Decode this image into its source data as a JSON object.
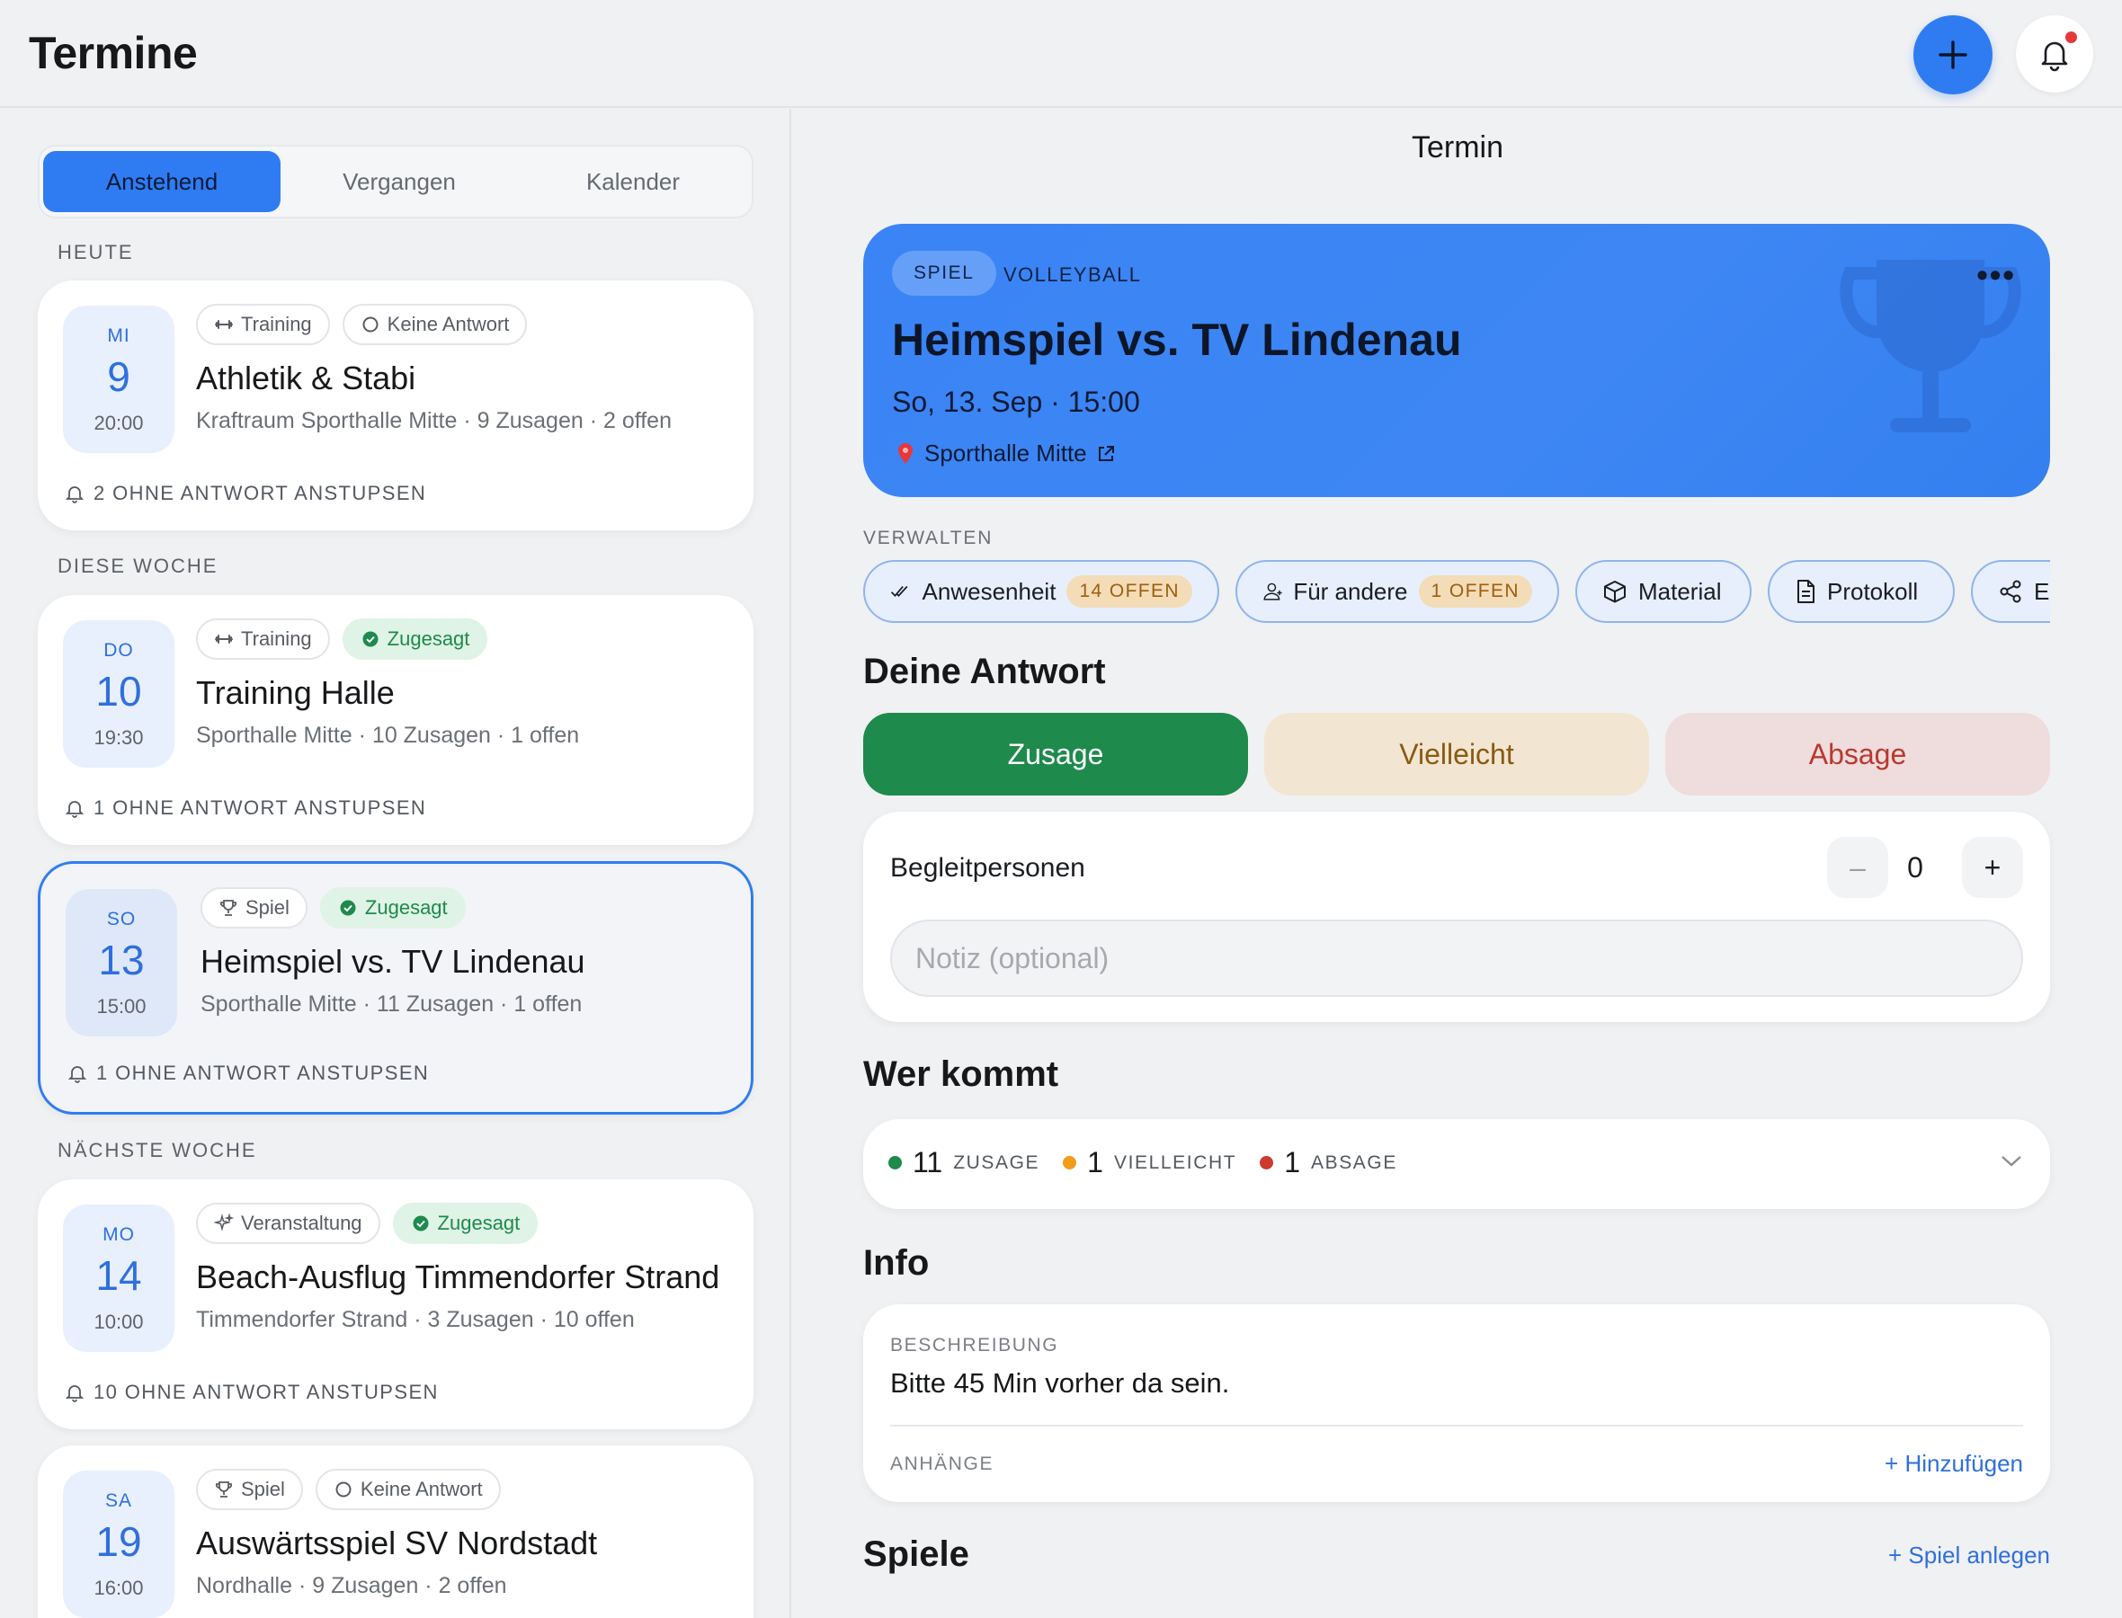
{
  "header": {
    "title": "Termine"
  },
  "tabs": [
    {
      "label": "Anstehend",
      "active": true
    },
    {
      "label": "Vergangen",
      "active": false
    },
    {
      "label": "Kalender",
      "active": false
    }
  ],
  "sections": {
    "today": "HEUTE",
    "this_week": "DIESE WOCHE",
    "next_week": "NÄCHSTE WOCHE"
  },
  "events": [
    {
      "dow": "MI",
      "day": "9",
      "time": "20:00",
      "type": "Training",
      "type_icon": "dumbbell-icon",
      "status": "Keine Antwort",
      "status_icon": "empty-circle-icon",
      "title": "Athletik & Stabi",
      "subtitle": "Kraftraum Sporthalle Mitte · 9 Zusagen · 2 offen",
      "nudge": "2 OHNE ANTWORT ANSTUPSEN"
    },
    {
      "dow": "DO",
      "day": "10",
      "time": "19:30",
      "type": "Training",
      "type_icon": "dumbbell-icon",
      "status": "Zugesagt",
      "status_icon": "check-circle-icon",
      "title": "Training Halle",
      "subtitle": "Sporthalle Mitte · 10 Zusagen · 1 offen",
      "nudge": "1 OHNE ANTWORT ANSTUPSEN"
    },
    {
      "dow": "SO",
      "day": "13",
      "time": "15:00",
      "type": "Spiel",
      "type_icon": "trophy-icon",
      "status": "Zugesagt",
      "status_icon": "check-circle-icon",
      "title": "Heimspiel vs. TV Lindenau",
      "subtitle": "Sporthalle Mitte · 11 Zusagen · 1 offen",
      "nudge": "1 OHNE ANTWORT ANSTUPSEN",
      "selected": true
    },
    {
      "dow": "MO",
      "day": "14",
      "time": "10:00",
      "type": "Veranstaltung",
      "type_icon": "sparkles-icon",
      "status": "Zugesagt",
      "status_icon": "check-circle-icon",
      "title": "Beach-Ausflug Timmendorfer Strand",
      "subtitle": "Timmendorfer Strand · 3 Zusagen · 10 offen",
      "nudge": "10 OHNE ANTWORT ANSTUPSEN"
    },
    {
      "dow": "SA",
      "day": "19",
      "time": "16:00",
      "type": "Spiel",
      "type_icon": "trophy-icon",
      "status": "Keine Antwort",
      "status_icon": "empty-circle-icon",
      "title": "Auswärtsspiel SV Nordstadt",
      "subtitle": "Nordhalle · 9 Zusagen · 2 offen"
    }
  ],
  "detail": {
    "pane_title": "Termin",
    "badge": "SPIEL",
    "sport": "VOLLEYBALL",
    "title": "Heimspiel vs. TV Lindenau",
    "datetime": "So, 13. Sep · 15:00",
    "location": "Sporthalle Mitte",
    "more": "•••",
    "manage_label": "VERWALTEN",
    "manage": [
      {
        "label": "Anwesenheit",
        "icon": "double-check-icon",
        "badge": "14 OFFEN"
      },
      {
        "label": "Für andere",
        "icon": "person-icon",
        "badge": "1 OFFEN"
      },
      {
        "label": "Material",
        "icon": "box-icon"
      },
      {
        "label": "Protokoll",
        "icon": "document-icon"
      },
      {
        "label": "Ex",
        "icon": "share-icon"
      }
    ],
    "your_answer_heading": "Deine Antwort",
    "answers": {
      "yes": "Zusage",
      "maybe": "Vielleicht",
      "no": "Absage"
    },
    "companions_label": "Begleitpersonen",
    "companions_value": "0",
    "minus": "–",
    "plus": "+",
    "note_placeholder": "Notiz (optional)",
    "who_heading": "Wer kommt",
    "who": [
      {
        "count": "11",
        "label": "ZUSAGE",
        "color": "#1e8a4c"
      },
      {
        "count": "1",
        "label": "VIELLEICHT",
        "color": "#f29c18"
      },
      {
        "count": "1",
        "label": "ABSAGE",
        "color": "#cc3b2d"
      }
    ],
    "info_heading": "Info",
    "description_label": "BESCHREIBUNG",
    "description": "Bitte 45 Min vorher da sein.",
    "attachments_label": "ANHÄNGE",
    "add_attachment": "+ Hinzufügen",
    "games_heading": "Spiele",
    "add_game": "+ Spiel anlegen"
  },
  "colors": {
    "accent": "#2f7cf2",
    "success": "#1e8a4c",
    "warning": "#f29c18",
    "danger": "#cc3b2d"
  }
}
